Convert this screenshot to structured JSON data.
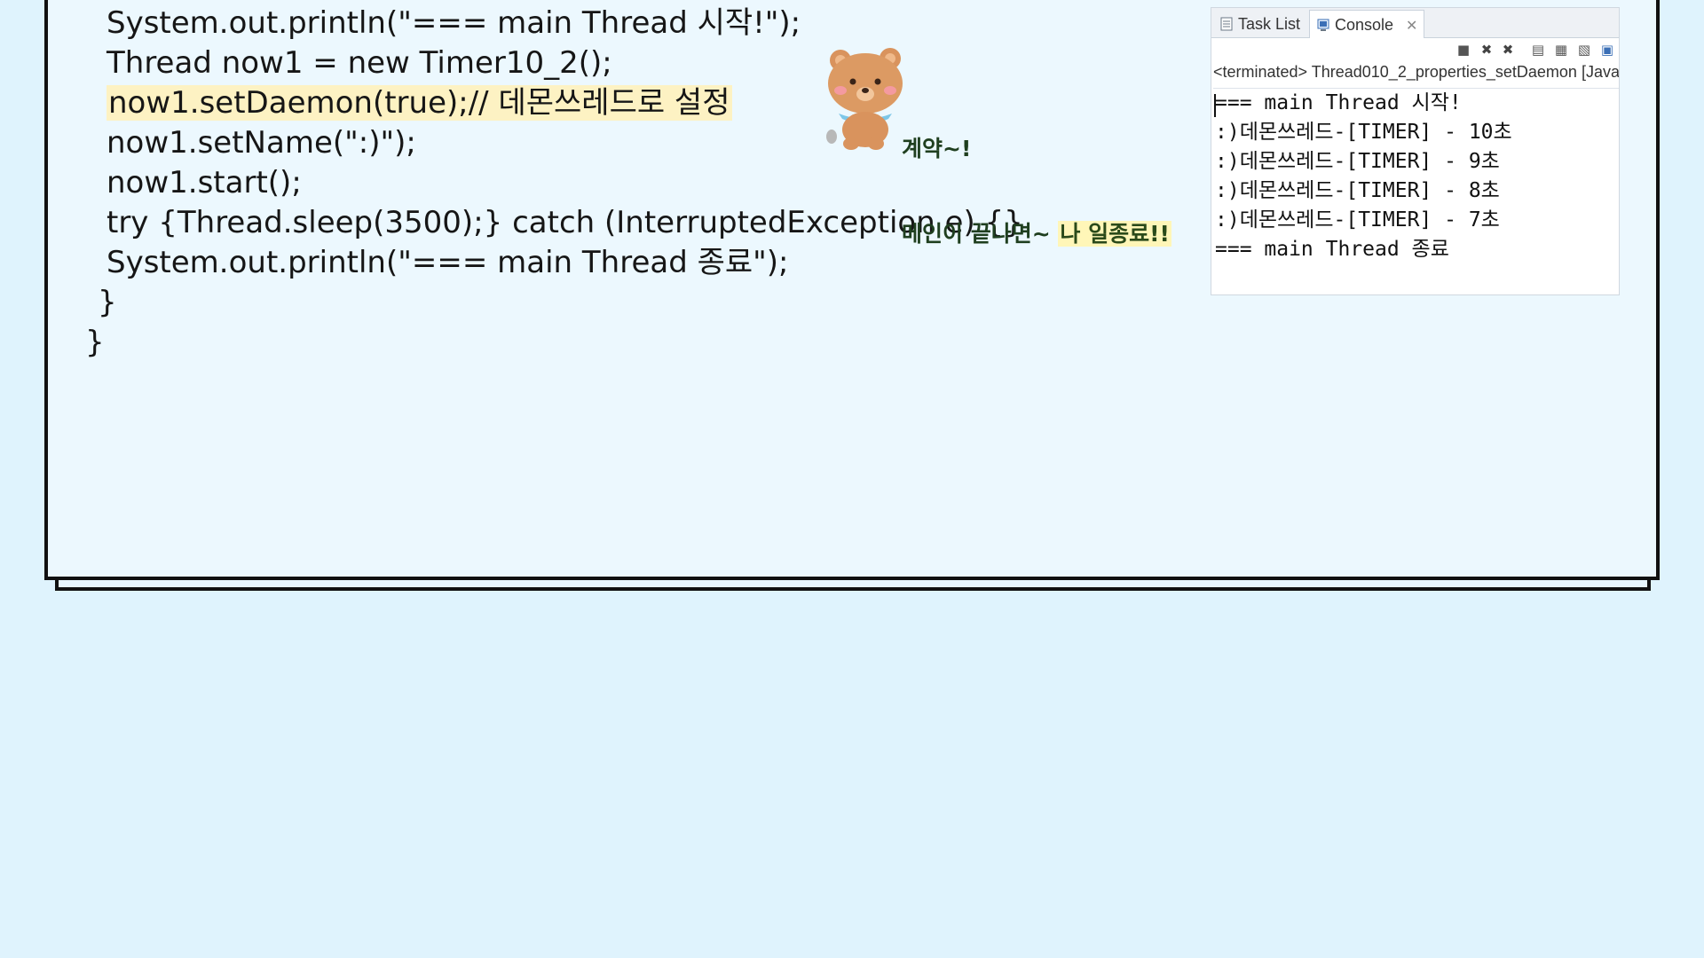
{
  "code": {
    "lines": [
      "System.out.println(\"=== main Thread 시작!\");",
      "Thread now1 = new Timer10_2();",
      "now1.setDaemon(true);// 데몬쓰레드로 설정",
      "now1.setName(\":)\");",
      "now1.start();",
      "try {Thread.sleep(3500);} catch (InterruptedException e) {}",
      "System.out.println(\"=== main Thread 종료\");",
      "}",
      "}"
    ]
  },
  "bubble": {
    "line1": "계약~!",
    "line2_prefix": "메인이 끝나면~ ",
    "line2_highlight": "나 일종료!!"
  },
  "console": {
    "tabs": [
      {
        "label": "Task List",
        "icon": "task-list-icon"
      },
      {
        "label": "Console",
        "icon": "console-icon",
        "active": true
      }
    ],
    "terminated_text": "<terminated> Thread010_2_properties_setDaemon [Java",
    "output": [
      "=== main Thread 시작!",
      ":)데몬쓰레드-[TIMER] - 10초",
      ":)데몬쓰레드-[TIMER] - 9초",
      ":)데몬쓰레드-[TIMER] - 8초",
      ":)데몬쓰레드-[TIMER] - 7초",
      "=== main Thread 종료"
    ]
  },
  "colors": {
    "background": "#dff3fd",
    "highlight": "#fdf2c3",
    "border": "#111111"
  }
}
